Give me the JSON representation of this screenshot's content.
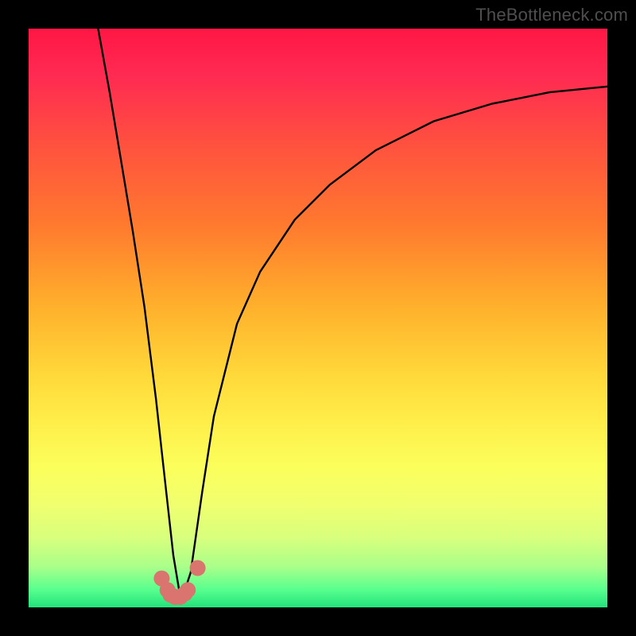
{
  "watermark": "TheBottleneck.com",
  "chart_data": {
    "type": "line",
    "title": "",
    "xlabel": "",
    "ylabel": "",
    "xlim": [
      0,
      100
    ],
    "ylim": [
      0,
      100
    ],
    "grid": false,
    "series": [
      {
        "name": "curve",
        "color": "#000000",
        "x": [
          12,
          14,
          16,
          18,
          20,
          22,
          23,
          24,
          25,
          26,
          27,
          28,
          29,
          30,
          32,
          36,
          40,
          46,
          52,
          60,
          70,
          80,
          90,
          100
        ],
        "y": [
          100,
          89,
          77,
          65,
          52,
          36,
          27,
          18,
          9,
          3,
          3,
          6,
          13,
          20,
          33,
          49,
          58,
          67,
          73,
          79,
          84,
          87,
          89,
          90
        ]
      }
    ],
    "markers": {
      "name": "highlight-dots",
      "color": "#d9746f",
      "size": 10,
      "x": [
        23.0,
        24.0,
        24.5,
        25.3,
        26.2,
        27.0,
        27.5,
        29.2
      ],
      "y": [
        5.0,
        3.0,
        2.2,
        1.8,
        1.8,
        2.4,
        3.0,
        6.8
      ]
    },
    "gradient_stops": [
      {
        "pos": 0.0,
        "color": "#ff1744"
      },
      {
        "pos": 0.08,
        "color": "#ff2a52"
      },
      {
        "pos": 0.2,
        "color": "#ff513f"
      },
      {
        "pos": 0.34,
        "color": "#ff7a2e"
      },
      {
        "pos": 0.48,
        "color": "#ffb02c"
      },
      {
        "pos": 0.6,
        "color": "#ffd93a"
      },
      {
        "pos": 0.68,
        "color": "#ffee4a"
      },
      {
        "pos": 0.76,
        "color": "#fbff5c"
      },
      {
        "pos": 0.82,
        "color": "#f1ff6e"
      },
      {
        "pos": 0.88,
        "color": "#d8ff7d"
      },
      {
        "pos": 0.93,
        "color": "#a9ff8a"
      },
      {
        "pos": 0.97,
        "color": "#57ff8e"
      },
      {
        "pos": 1.0,
        "color": "#22e27a"
      }
    ]
  }
}
